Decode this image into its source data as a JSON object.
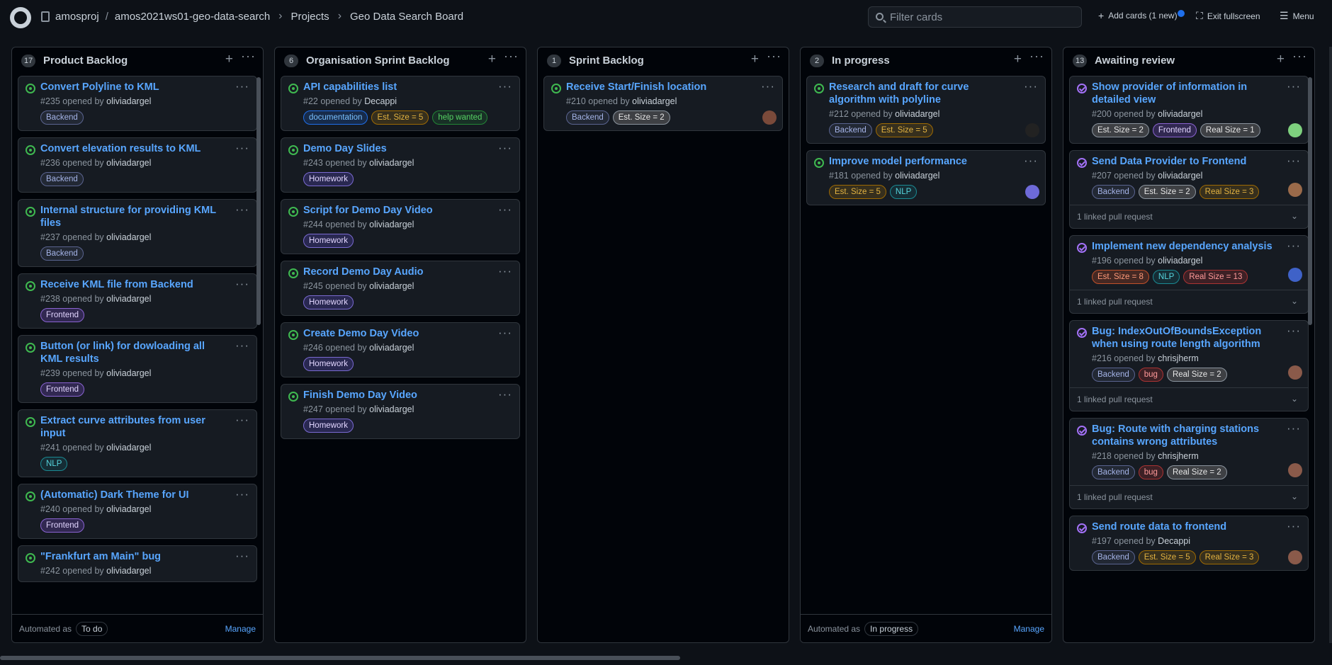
{
  "header": {
    "owner": "amosproj",
    "separator": "/",
    "repo": "amos2021ws01-geo-data-search",
    "projects": "Projects",
    "board": "Geo Data Search Board",
    "filter_placeholder": "Filter cards",
    "add_cards_label": "Add cards (1 new)",
    "exit_fullscreen_label": "Exit fullscreen",
    "menu_label": "Menu"
  },
  "colors": {
    "background": "#0d1117",
    "link": "#58a6ff",
    "open_status": "#3fb950",
    "closed_status": "#a371f7"
  },
  "columns": [
    {
      "title": "Product Backlog",
      "count": "17",
      "automated_label": "Automated as",
      "automated_value": "To do",
      "manage": "Manage",
      "cards": [
        {
          "title": "Convert Polyline to KML",
          "number": "#235",
          "opened_by": "opened by",
          "author": "oliviadargel",
          "status": "open",
          "labels": [
            "Backend"
          ]
        },
        {
          "title": "Convert elevation results to KML",
          "number": "#236",
          "opened_by": "opened by",
          "author": "oliviadargel",
          "status": "open",
          "labels": [
            "Backend"
          ]
        },
        {
          "title": "Internal structure for providing KML files",
          "number": "#237",
          "opened_by": "opened by",
          "author": "oliviadargel",
          "status": "open",
          "labels": [
            "Backend"
          ]
        },
        {
          "title": "Receive KML file from Backend",
          "number": "#238",
          "opened_by": "opened by",
          "author": "oliviadargel",
          "status": "open",
          "labels": [
            "Frontend"
          ]
        },
        {
          "title": "Button (or link) for dowloading all KML results",
          "number": "#239",
          "opened_by": "opened by",
          "author": "oliviadargel",
          "status": "open",
          "labels": [
            "Frontend"
          ]
        },
        {
          "title": "Extract curve attributes from user input",
          "number": "#241",
          "opened_by": "opened by",
          "author": "oliviadargel",
          "status": "open",
          "labels": [
            "NLP"
          ]
        },
        {
          "title": "(Automatic) Dark Theme for UI",
          "number": "#240",
          "opened_by": "opened by",
          "author": "oliviadargel",
          "status": "open",
          "labels": [
            "Frontend"
          ]
        },
        {
          "title": "\"Frankfurt am Main\" bug",
          "number": "#242",
          "opened_by": "opened by",
          "author": "oliviadargel",
          "status": "open",
          "labels": []
        }
      ]
    },
    {
      "title": "Organisation Sprint Backlog",
      "count": "6",
      "cards": [
        {
          "title": "API capabilities list",
          "number": "#22",
          "opened_by": "opened by",
          "author": "Decappi",
          "status": "open",
          "labels": [
            "documentation",
            "Est. Size = 5",
            "help wanted"
          ]
        },
        {
          "title": "Demo Day Slides",
          "number": "#243",
          "opened_by": "opened by",
          "author": "oliviadargel",
          "status": "open",
          "labels": [
            "Homework"
          ]
        },
        {
          "title": "Script for Demo Day Video",
          "number": "#244",
          "opened_by": "opened by",
          "author": "oliviadargel",
          "status": "open",
          "labels": [
            "Homework"
          ]
        },
        {
          "title": "Record Demo Day Audio",
          "number": "#245",
          "opened_by": "opened by",
          "author": "oliviadargel",
          "status": "open",
          "labels": [
            "Homework"
          ]
        },
        {
          "title": "Create Demo Day Video",
          "number": "#246",
          "opened_by": "opened by",
          "author": "oliviadargel",
          "status": "open",
          "labels": [
            "Homework"
          ]
        },
        {
          "title": "Finish Demo Day Video",
          "number": "#247",
          "opened_by": "opened by",
          "author": "oliviadargel",
          "status": "open",
          "labels": [
            "Homework"
          ]
        }
      ]
    },
    {
      "title": "Sprint Backlog",
      "count": "1",
      "cards": [
        {
          "title": "Receive Start/Finish location",
          "number": "#210",
          "opened_by": "opened by",
          "author": "oliviadargel",
          "status": "open",
          "labels": [
            "Backend",
            "Est. Size = 2"
          ],
          "avatar": "#7a4a3a"
        }
      ]
    },
    {
      "title": "In progress",
      "count": "2",
      "automated_label": "Automated as",
      "automated_value": "In progress",
      "manage": "Manage",
      "cards": [
        {
          "title": "Research and draft for curve algorithm with polyline",
          "number": "#212",
          "opened_by": "opened by",
          "author": "oliviadargel",
          "status": "open",
          "labels": [
            "Backend",
            "Est. Size = 5"
          ],
          "avatar": "#222222"
        },
        {
          "title": "Improve model performance",
          "number": "#181",
          "opened_by": "opened by",
          "author": "oliviadargel",
          "status": "open",
          "labels": [
            "Est. Size = 5",
            "NLP"
          ],
          "avatar": "#6e6ad8"
        }
      ]
    },
    {
      "title": "Awaiting review",
      "count": "13",
      "cards": [
        {
          "title": "Show provider of information in detailed view",
          "number": "#200",
          "opened_by": "opened by",
          "author": "oliviadargel",
          "status": "closed",
          "labels": [
            "Est. Size = 2",
            "Frontend",
            "Real Size = 1"
          ],
          "avatar": "#7ed07e"
        },
        {
          "title": "Send Data Provider to Frontend",
          "number": "#207",
          "opened_by": "opened by",
          "author": "oliviadargel",
          "status": "closed",
          "labels": [
            "Backend",
            "Est. Size = 2",
            "Real Size = 3"
          ],
          "avatar": "#9a6a4a",
          "linked": "1 linked pull request"
        },
        {
          "title": "Implement new dependency analysis",
          "number": "#196",
          "opened_by": "opened by",
          "author": "oliviadargel",
          "status": "closed",
          "labels": [
            "Est. Size = 8",
            "NLP",
            "Real Size = 13"
          ],
          "avatar": "#3f62c8",
          "linked": "1 linked pull request"
        },
        {
          "title": "Bug: IndexOutOfBoundsException when using route length algorithm",
          "number": "#216",
          "opened_by": "opened by",
          "author": "chrisjherm",
          "status": "closed",
          "labels": [
            "Backend",
            "bug",
            "Real Size = 2"
          ],
          "avatar": "#8a5a4a",
          "linked": "1 linked pull request"
        },
        {
          "title": "Bug: Route with charging stations contains wrong attributes",
          "number": "#218",
          "opened_by": "opened by",
          "author": "chrisjherm",
          "status": "closed",
          "labels": [
            "Backend",
            "bug",
            "Real Size = 2"
          ],
          "avatar": "#8a5a4a",
          "linked": "1 linked pull request"
        },
        {
          "title": "Send route data to frontend",
          "number": "#197",
          "opened_by": "opened by",
          "author": "Decappi",
          "status": "closed",
          "labels": [
            "Backend",
            "Est. Size = 5",
            "Real Size = 3"
          ],
          "avatar": "#8a5a4a"
        }
      ]
    }
  ],
  "label_colors": {
    "Backend": {
      "fg": "#a5b4e8",
      "bg": "rgba(110,118,160,0.15)",
      "border": "#5a6490"
    },
    "Frontend": {
      "fg": "#e2d6ff",
      "bg": "rgba(130,80,223,0.25)",
      "border": "#8a63d2"
    },
    "NLP": {
      "fg": "#56d4dd",
      "bg": "rgba(20,120,130,0.2)",
      "border": "#1b8a93"
    },
    "Homework": {
      "fg": "#e2d6ff",
      "bg": "rgba(100,80,223,0.25)",
      "border": "#7a6ad2"
    },
    "documentation": {
      "fg": "#79c0ff",
      "bg": "rgba(31,111,235,0.2)",
      "border": "#1f6feb"
    },
    "help wanted": {
      "fg": "#56d364",
      "bg": "rgba(35,134,54,0.2)",
      "border": "#238636"
    },
    "bug": {
      "fg": "#ff9a9a",
      "bg": "rgba(218,54,51,0.2)",
      "border": "#a33"
    },
    "Est. Size = 2": {
      "fg": "#e6e6e6",
      "bg": "rgba(110,110,110,0.45)",
      "border": "#8b949e"
    },
    "Est. Size = 5": {
      "fg": "#e3b341",
      "bg": "rgba(187,128,9,0.2)",
      "border": "#9e6a03"
    },
    "Est. Size = 8": {
      "fg": "#ff9a7a",
      "bg": "rgba(210,80,40,0.25)",
      "border": "#c0502a"
    },
    "Real Size = 1": {
      "fg": "#e6e6e6",
      "bg": "rgba(110,110,110,0.45)",
      "border": "#8b949e"
    },
    "Real Size = 2": {
      "fg": "#e6e6e6",
      "bg": "rgba(110,110,110,0.45)",
      "border": "#8b949e"
    },
    "Real Size = 3": {
      "fg": "#e3b341",
      "bg": "rgba(187,128,9,0.2)",
      "border": "#9e6a03"
    },
    "Real Size = 13": {
      "fg": "#ff9a9a",
      "bg": "rgba(218,54,51,0.2)",
      "border": "#a33"
    }
  },
  "icons": {
    "logo": "github-logo-icon",
    "repo": "repo-icon",
    "search": "search-icon",
    "plus": "plus-icon",
    "fullscreen": "screen-normal-icon",
    "menu": "hamburger-icon",
    "more": "kebab-horizontal-icon",
    "open_issue": "issue-opened-icon",
    "closed_issue": "issue-closed-icon",
    "chevron": "chevron-down-icon"
  }
}
